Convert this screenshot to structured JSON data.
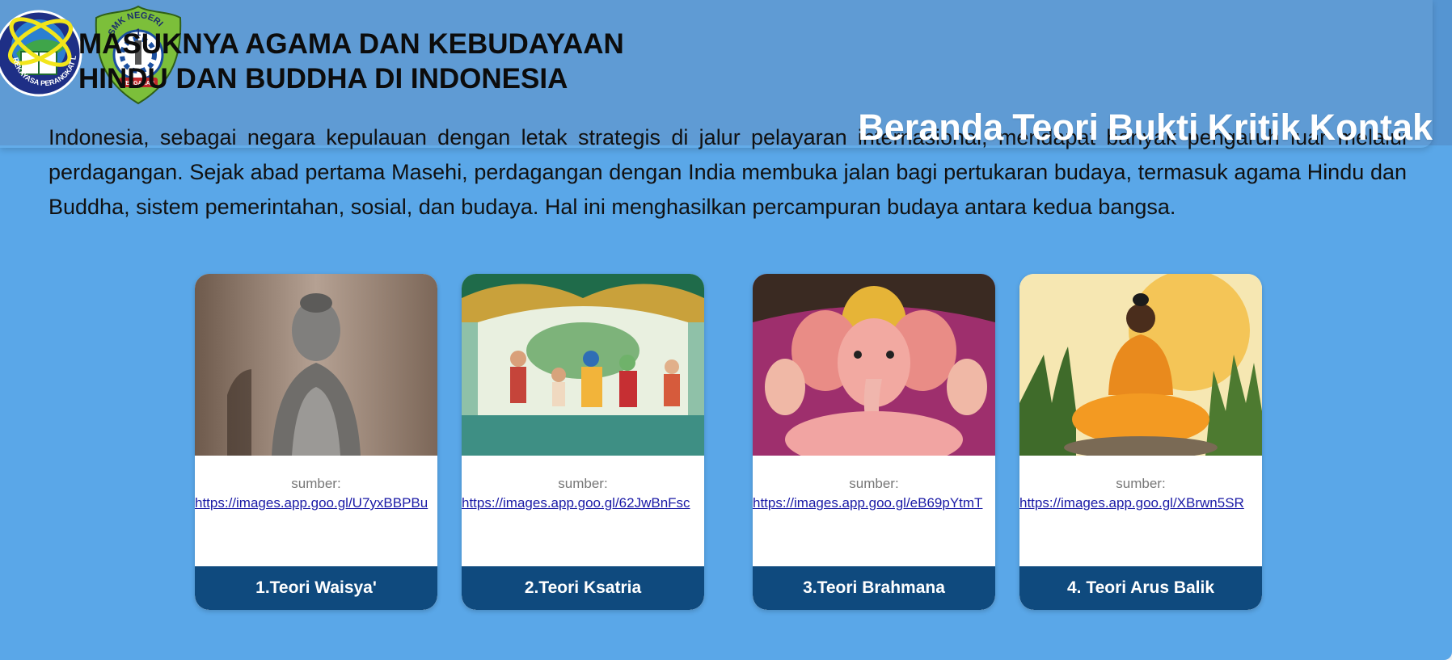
{
  "header": {
    "title_line1": "MASUKNYA AGAMA DAN KEBUDAYAAN",
    "title_line2": "HINDU DAN BUDDHA DI INDONESIA",
    "logo_left_text": "REKAYASA PERANGKAT LUNAK",
    "logo_right_text_top": "SMK NEGERI",
    "logo_right_number": "1",
    "logo_right_text_bottom": "TENGARAN"
  },
  "nav": {
    "items": [
      "Beranda",
      "Teori",
      "Bukti",
      "Kritik",
      "Kontak"
    ]
  },
  "intro": "Indonesia, sebagai negara kepulauan dengan letak strategis di jalur pelayaran internasional, mendapat banyak pengaruh luar melalui perdagangan. Sejak abad pertama Masehi, perdagangan dengan India membuka jalan bagi pertukaran budaya, termasuk agama Hindu dan Buddha, sistem pemerintahan, sosial, dan budaya. Hal ini menghasilkan percampuran budaya antara kedua bangsa.",
  "cards": [
    {
      "source_label": "sumber:",
      "source_link": "https://images.app.goo.gl/U7yxBBPBu",
      "button": "1.Teori Waisya'"
    },
    {
      "source_label": "sumber:",
      "source_link": "https://images.app.goo.gl/62JwBnFsc",
      "button": "2.Teori Ksatria"
    },
    {
      "source_label": "sumber:",
      "source_link": "https://images.app.goo.gl/eB69pYtmT",
      "button": "3.Teori Brahmana"
    },
    {
      "source_label": "sumber:",
      "source_link": "https://images.app.goo.gl/XBrwn5SR",
      "button": "4. Teori Arus Balik"
    }
  ],
  "colors": {
    "page_bg": "#5aa7e8",
    "header_bg": "#5595d2",
    "button_bg": "#0f4a7e",
    "link": "#1a1aa6"
  }
}
